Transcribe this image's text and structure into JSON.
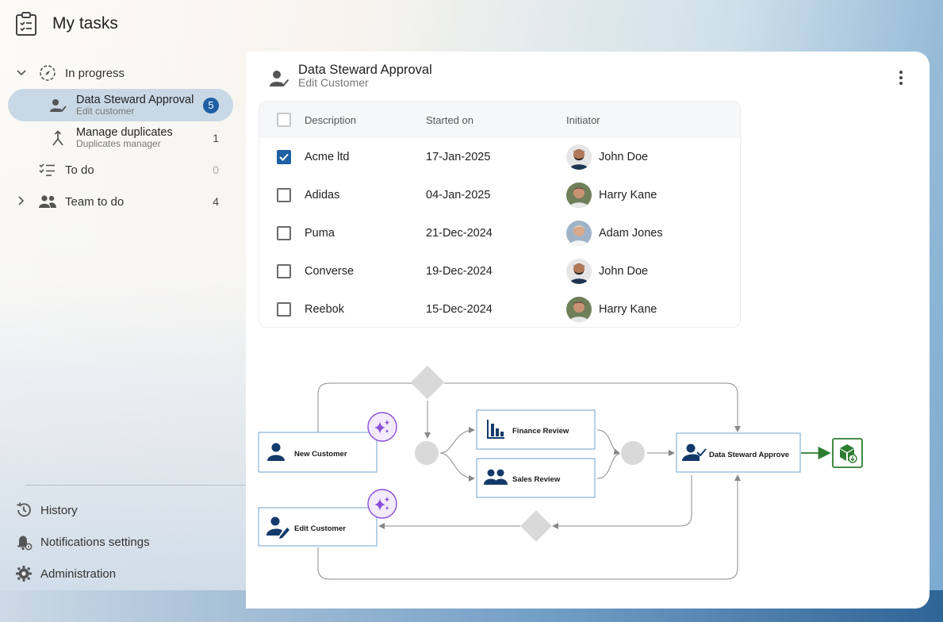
{
  "header": {
    "title": "My tasks",
    "icon": "clipboard-list-icon"
  },
  "nav": {
    "in_progress": {
      "label": "In progress",
      "icon": "progress-compass-icon"
    },
    "in_progress_items": [
      {
        "title": "Data Steward Approval",
        "subtitle": "Edit customer",
        "count": "5",
        "icon": "user-check-icon"
      },
      {
        "title": "Manage duplicates",
        "subtitle": "Duplicates manager",
        "count": "1",
        "icon": "merge-icon"
      }
    ],
    "todo": {
      "label": "To do",
      "count": "0",
      "icon": "checklist-icon"
    },
    "team_todo": {
      "label": "Team to do",
      "count": "4",
      "icon": "team-icon"
    }
  },
  "bottom_nav": [
    {
      "label": "History",
      "icon": "history-icon"
    },
    {
      "label": "Notifications settings",
      "icon": "bell-settings-icon"
    },
    {
      "label": "Administration",
      "icon": "gear-icon"
    }
  ],
  "task": {
    "title": "Data Steward Approval",
    "subtitle": "Edit Customer"
  },
  "table": {
    "columns": [
      "Description",
      "Started on",
      "Initiator"
    ],
    "rows": [
      {
        "description": "Acme ltd",
        "started": "17-Jan-2025",
        "initiator": "John Doe",
        "checked": true
      },
      {
        "description": "Adidas",
        "started": "04-Jan-2025",
        "initiator": "Harry Kane",
        "checked": false
      },
      {
        "description": "Puma",
        "started": "21-Dec-2024",
        "initiator": "Adam Jones",
        "checked": false
      },
      {
        "description": "Converse",
        "started": "19-Dec-2024",
        "initiator": "John Doe",
        "checked": false
      },
      {
        "description": "Reebok",
        "started": "15-Dec-2024",
        "initiator": "Harry Kane",
        "checked": false
      }
    ]
  },
  "workflow": {
    "nodes": {
      "new_customer": "New Customer",
      "edit_customer": "Edit Customer",
      "finance_review": "Finance Review",
      "sales_review": "Sales Review",
      "data_steward_approve": "Data Steward Approve"
    }
  },
  "colors": {
    "accent": "#1f5fa3",
    "navy": "#143a6b",
    "ai_purple": "#8a4fd6",
    "success_green": "#2e7d32"
  }
}
